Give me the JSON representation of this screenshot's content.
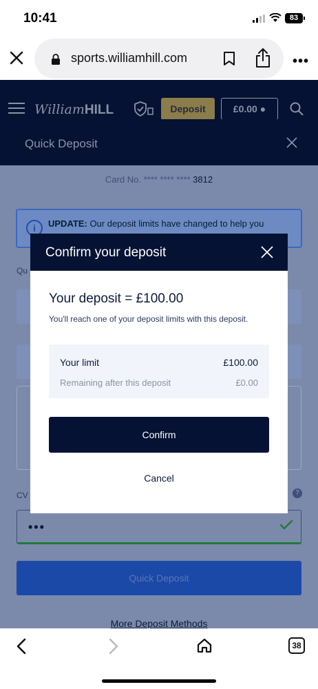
{
  "status_bar": {
    "time": "10:41",
    "battery": "83"
  },
  "browser": {
    "url": "sports.williamhill.com",
    "more_label": "•••"
  },
  "header": {
    "logo_script": "William",
    "logo_bold": "HILL",
    "deposit_label": "Deposit",
    "balance": "£0.00"
  },
  "quick_deposit": {
    "title": "Quick Deposit",
    "card_label": "Card No.",
    "card_masked": "**** **** ****",
    "card_last4": "3812",
    "update_bold": "UPDATE:",
    "update_text": "Our deposit limits have changed to help you",
    "label_small": "Qu",
    "cvv_label": "CV",
    "cvv_value": "•••",
    "submit_label": "Quick Deposit",
    "more_methods": "More Deposit Methods"
  },
  "modal": {
    "title": "Confirm your deposit",
    "amount_text": "Your deposit = £100.00",
    "note": "You'll reach one of your deposit limits with this deposit.",
    "limit_label": "Your limit",
    "limit_value": "£100.00",
    "remaining_label": "Remaining after this deposit",
    "remaining_value": "£0.00",
    "confirm_label": "Confirm",
    "cancel_label": "Cancel"
  },
  "bottom_bar": {
    "tab_count": "38"
  },
  "colors": {
    "navy": "#061233",
    "overlay_body": "#7b8aab",
    "submit_blue": "#1b49a8",
    "success_green": "#1e7a3a",
    "limit_box_bg": "#f1f4fb"
  }
}
